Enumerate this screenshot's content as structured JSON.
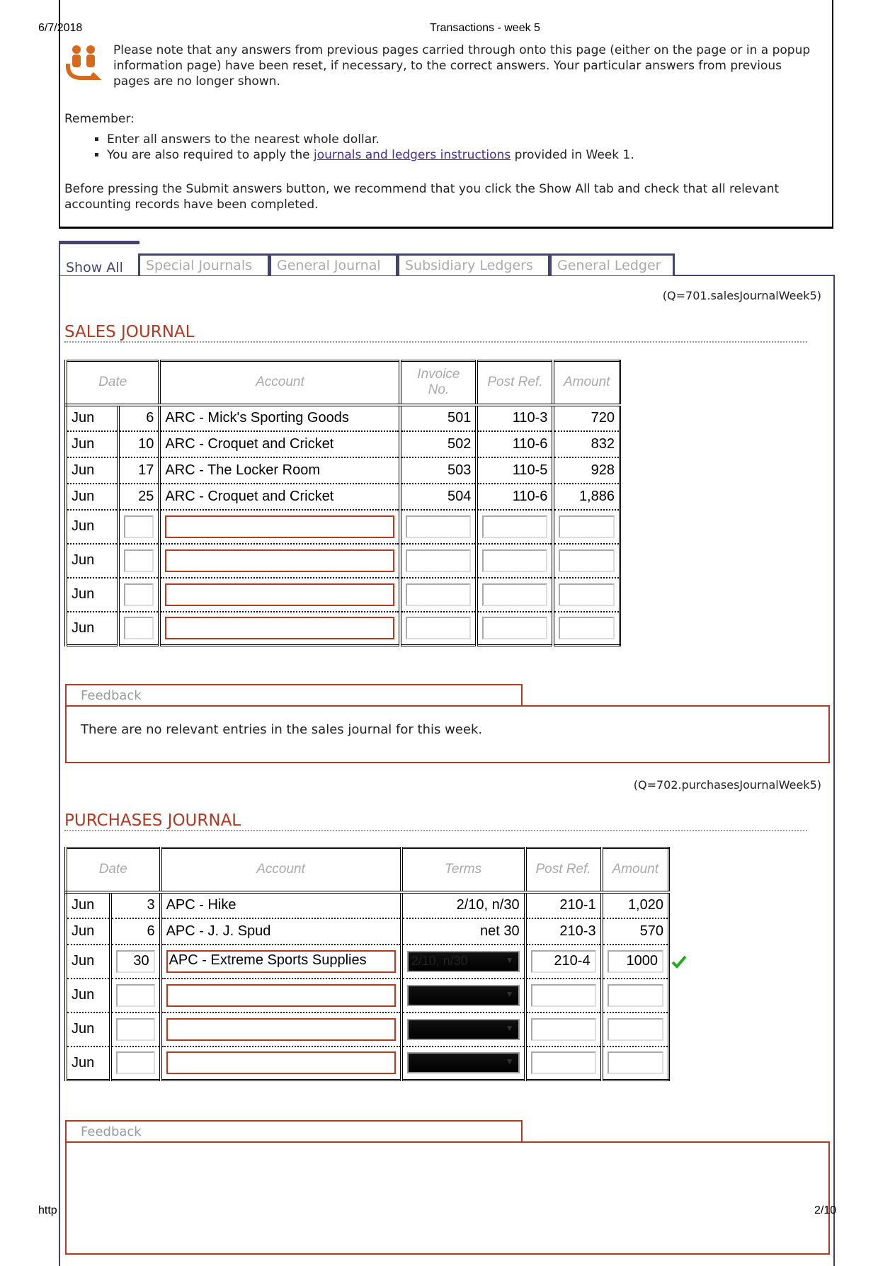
{
  "header": {
    "date": "6/7/2018",
    "title": "Transactions - week 5",
    "footer_left": "http",
    "page": "2/10"
  },
  "notice": {
    "text": "Please note that any answers from previous pages carried through onto this page (either on the page or in a popup information page) have been reset, if necessary, to the correct answers. Your particular answers from previous pages are no longer shown.",
    "remember": "Remember:",
    "bullet1": "Enter all answers to the nearest whole dollar.",
    "bullet2_pre": "You are also required to apply the ",
    "bullet2_link": "journals and ledgers instructions",
    "bullet2_post": " provided in Week 1.",
    "before": "Before pressing the Submit answers button, we recommend that you click the Show All tab and check that all relevant accounting records have been completed."
  },
  "tabs": [
    "Show All",
    "Special Journals",
    "General Journal",
    "Subsidiary Ledgers",
    "General Ledger"
  ],
  "sales": {
    "qref": "(Q=701.salesJournalWeek5)",
    "title": "SALES JOURNAL",
    "headers": [
      "Date",
      "Account",
      "Invoice No.",
      "Post Ref.",
      "Amount"
    ],
    "rows": [
      [
        "Jun",
        "6",
        "ARC - Mick's Sporting Goods",
        "501",
        "110-3",
        "720"
      ],
      [
        "Jun",
        "10",
        "ARC - Croquet and Cricket",
        "502",
        "110-6",
        "832"
      ],
      [
        "Jun",
        "17",
        "ARC - The Locker Room",
        "503",
        "110-5",
        "928"
      ],
      [
        "Jun",
        "25",
        "ARC - Croquet and Cricket",
        "504",
        "110-6",
        "1,886"
      ]
    ],
    "input_month": "Jun",
    "feedback_label": "Feedback",
    "feedback": "There are no relevant entries in the sales journal for this week."
  },
  "purchases": {
    "qref": "(Q=702.purchasesJournalWeek5)",
    "title": "PURCHASES JOURNAL",
    "headers": [
      "Date",
      "Account",
      "Terms",
      "Post Ref.",
      "Amount"
    ],
    "rows": [
      [
        "Jun",
        "3",
        "APC - Hike",
        "2/10, n/30",
        "210-1",
        "1,020"
      ],
      [
        "Jun",
        "6",
        "APC - J. J. Spud",
        "net 30",
        "210-3",
        "570"
      ]
    ],
    "entry": {
      "month": "Jun",
      "day": "30",
      "account": "APC - Extreme Sports Supplies",
      "terms": "2/10, n/30",
      "post": "210-4",
      "amount": "1000",
      "status": "correct"
    },
    "input_month": "Jun",
    "feedback_label": "Feedback"
  },
  "colors": {
    "accent": "#b03a22",
    "tab": "#44446e",
    "check": "#22aa22"
  }
}
